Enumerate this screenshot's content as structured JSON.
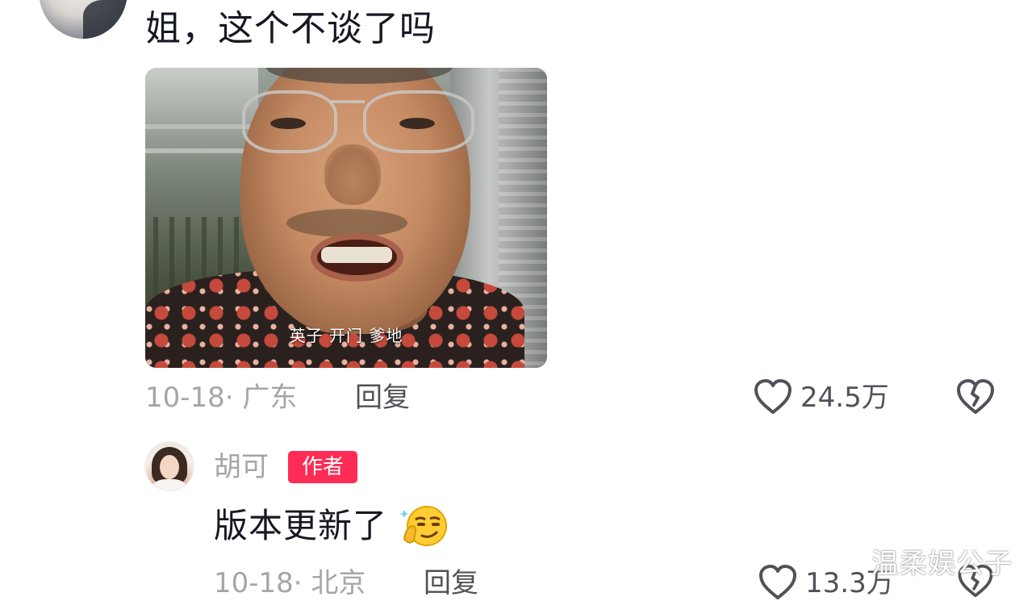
{
  "comments": [
    {
      "text": "姐，这个不谈了吗",
      "image": {
        "subtitle": "英子 开门 爹地"
      },
      "date": "10-18",
      "location": "· 广东",
      "reply_label": "回复",
      "like_count": "24.5万"
    },
    {
      "username": "胡可",
      "badge": "作者",
      "text": "版本更新了",
      "emoji": "thinking-smirk-emoji",
      "date": "10-18",
      "location": "· 北京",
      "reply_label": "回复",
      "like_count": "13.3万"
    }
  ],
  "watermark": "温柔娱公子",
  "colors": {
    "badge": "#fe2c55",
    "meta": "#a5a5aa",
    "text": "#161823"
  },
  "icons": {
    "like": "heart-outline-icon",
    "dislike": "broken-heart-icon"
  }
}
